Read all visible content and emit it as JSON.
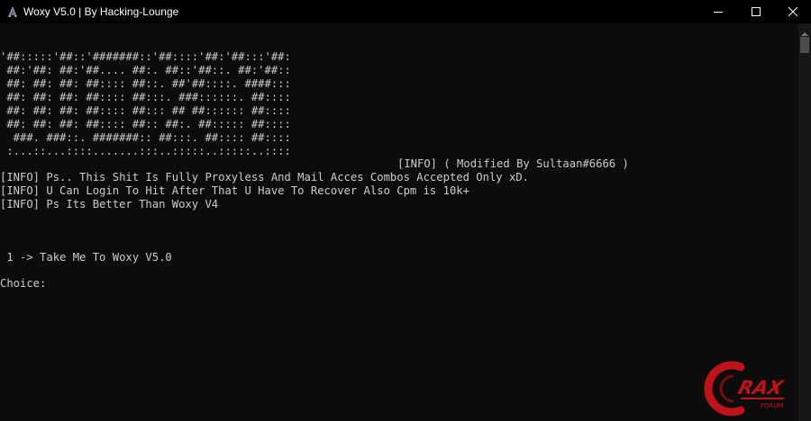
{
  "window": {
    "title": "Woxy V5.0 | By Hacking-Lounge",
    "icon": "console-app-icon"
  },
  "console": {
    "banner": [
      "'##:::::'##::'#######::'##::::'##:'##:::'##:",
      " ##:'##: ##:'##.... ##:. ##::'##::. ##:'##::",
      " ##: ##: ##: ##:::: ##::. ##'##::::. ####:::",
      " ##: ##: ##: ##:::: ##:::. ###::::::. ##::::",
      " ##: ##: ##: ##:::: ##::: ## ##:::::: ##::::",
      " ##: ##: ##: ##:::: ##:: ##:. ##::::: ##::::",
      "  ###. ###::. #######:: ##:::. ##:::: ##::::",
      " :...::...::::.......:::..:::::..:::::..::::"
    ],
    "modified_line": "[INFO] ( Modified By Sultaan#6666 )",
    "info_lines": [
      "[INFO] Ps.. This Shit Is Fully Proxyless And Mail Acces Combos Accepted Only xD.",
      "[INFO] U Can Login To Hit After That U Have To Recover Also Cpm is 10k+",
      "[INFO] Ps Its Better Than Woxy V4"
    ],
    "menu_option": " 1 -> Take Me To Woxy V5.0",
    "prompt": "Choice:"
  },
  "watermark": {
    "brand": "RAX",
    "sub": "FORUM"
  },
  "colors": {
    "background": "#0c0c0c",
    "text": "#cccccc",
    "titlebar": "#000000",
    "watermark_red": "#c0121a"
  }
}
